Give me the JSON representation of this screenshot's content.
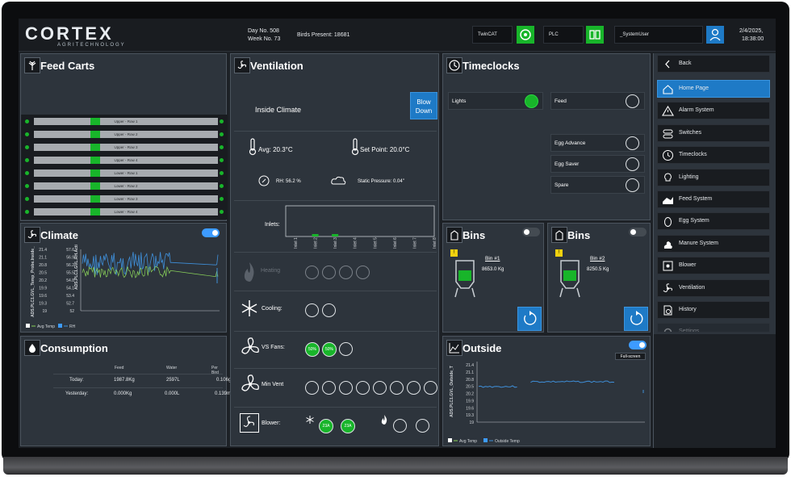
{
  "header": {
    "brand": "CORTEX",
    "tagline": "AGRITECHNOLOGY",
    "day_no": "Day No. 508",
    "week_no": "Week No. 73",
    "birds_present": "Birds Present: 18681",
    "twincat_label": "TwinCAT",
    "plc_label": "PLC",
    "user_label": "_SystemUser",
    "date": "2/4/2025,",
    "time": "18:38:00"
  },
  "feed_carts": {
    "title": "Feed Carts",
    "rows": [
      "Upper - Row 1",
      "Upper - Row 2",
      "Upper - Row 3",
      "Upper - Row 4",
      "Lower - Row 1",
      "Lower - Row 2",
      "Lower - Row 3",
      "Lower - Row 4"
    ]
  },
  "climate": {
    "title": "Climate",
    "left_axis_label": "ADS.PLC1.GVL_Temp_Probe.Inside_",
    "right_axis_label": "ADS.PLC1.GVL.RH.Acti",
    "left_ticks": [
      "21.4",
      "21.1",
      "20.8",
      "20.5",
      "20.2",
      "19.9",
      "19.6",
      "19.3",
      "19"
    ],
    "right_ticks": [
      "57.6",
      "56.9",
      "56.2",
      "55.5",
      "54.8",
      "54.1",
      "53.4",
      "52.7",
      "52"
    ],
    "legend": [
      "Avg Temp",
      "RH"
    ],
    "colors": {
      "temp": "#8bd45a",
      "rh": "#3f8fd9"
    }
  },
  "consumption": {
    "title": "Consumption",
    "headers": [
      "Feed",
      "Water",
      "Per Bird"
    ],
    "rows": [
      {
        "label": "Today:",
        "feed": "1987.8Kg",
        "water": "2597L",
        "per_bird_feed": "0.106g",
        "per_bird_water": ""
      },
      {
        "label": "Yesterday:",
        "feed": "0.000Kg",
        "water": "0.000L",
        "per_bird_feed": "",
        "per_bird_water": "0.139ml"
      }
    ]
  },
  "ventilation": {
    "title": "Ventilation",
    "inside_climate": "Inside Climate",
    "blow_down": "Blow Down",
    "avg": "Avg: 20.3°C",
    "set_point": "Set Point: 20.0°C",
    "rh": "RH: 56.2 %",
    "static_pressure": "Static Pressure: 0.04\"",
    "inlets_label": "Inlets:",
    "inlet_ticks": [
      "Inlet 1",
      "Inlet 2",
      "Inlet 3",
      "Inlet 4",
      "Inlet 5",
      "Inlet 6",
      "Inlet 7",
      "Inlet 8"
    ],
    "inlet_values": [
      0,
      1,
      1,
      0,
      0,
      0,
      0,
      0
    ],
    "heating": "Heating",
    "cooling": "Cooling:",
    "vs_fans": "VS Fans:",
    "vs_fan_values": [
      "50%",
      "50%"
    ],
    "min_vent": "Min Vent",
    "blower": "Blower:",
    "blower_values": [
      "23A",
      "23A"
    ]
  },
  "timeclocks": {
    "title": "Timeclocks",
    "items": [
      {
        "label": "Lights",
        "on": true
      },
      {
        "label": "Feed",
        "on": false
      },
      {
        "label": "Egg Advance",
        "on": false
      },
      {
        "label": "Egg Saver",
        "on": false
      },
      {
        "label": "Spare",
        "on": false
      }
    ]
  },
  "bins": [
    {
      "title": "Bins",
      "name": "Bin #1",
      "weight": "8653.0 Kg",
      "fill_pct": 60
    },
    {
      "title": "Bins",
      "name": "Bin #2",
      "weight": "8250.5 Kg",
      "fill_pct": 60
    }
  ],
  "outside": {
    "title": "Outside",
    "fullscreen": "Full-screen",
    "axis_label": "ADS.PLC1.GVL_Outside_T",
    "ticks": [
      "21.4",
      "21.1",
      "20.8",
      "20.5",
      "20.2",
      "19.9",
      "19.6",
      "19.3",
      "19"
    ],
    "legend": [
      "Avg Temp",
      "Outside Temp"
    ],
    "colors": {
      "avg": "#8bd45a",
      "outside": "#3f8fd9"
    }
  },
  "sidebar": {
    "back": "Back",
    "items": [
      "Home Page",
      "Alarm System",
      "Switches",
      "Timeclocks",
      "Lighting",
      "Feed System",
      "Egg System",
      "Manure System",
      "Blower",
      "Ventilation",
      "History",
      "Settings"
    ]
  },
  "colors": {
    "accent": "#1e7ac6",
    "active_green": "#18b52a",
    "panel": "#2d343c"
  }
}
